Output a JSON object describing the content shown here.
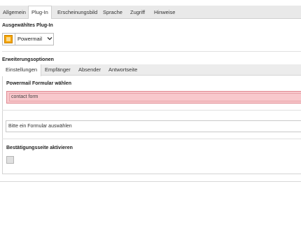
{
  "top_tabs": [
    {
      "label": "Allgemein"
    },
    {
      "label": "Plug-In"
    },
    {
      "label": "Erscheinungsbild"
    },
    {
      "label": "Sprache"
    },
    {
      "label": "Zugriff"
    },
    {
      "label": "Hinweise"
    }
  ],
  "active_top_tab": "Plug-In",
  "selected_plugin": {
    "title": "Ausgewähltes Plug-In",
    "value": "Powermail",
    "icon": "plugin-icon"
  },
  "extension_options": {
    "title": "Erweiterungsoptionen",
    "tabs": [
      {
        "label": "Einstellungen"
      },
      {
        "label": "Empfänger"
      },
      {
        "label": "Absender"
      },
      {
        "label": "Antwortseite"
      }
    ],
    "active_tab": "Einstellungen",
    "form_section": {
      "title": "Powermail Formular wählen",
      "selected_item": "contact form",
      "select_placeholder": "Bitte ein Formular auswählen"
    },
    "confirmation": {
      "title": "Bestätigungsseite aktivieren",
      "checked": false
    }
  },
  "colors": {
    "error_bg": "#f8c8cc",
    "plugin_icon": "#f6a400"
  }
}
